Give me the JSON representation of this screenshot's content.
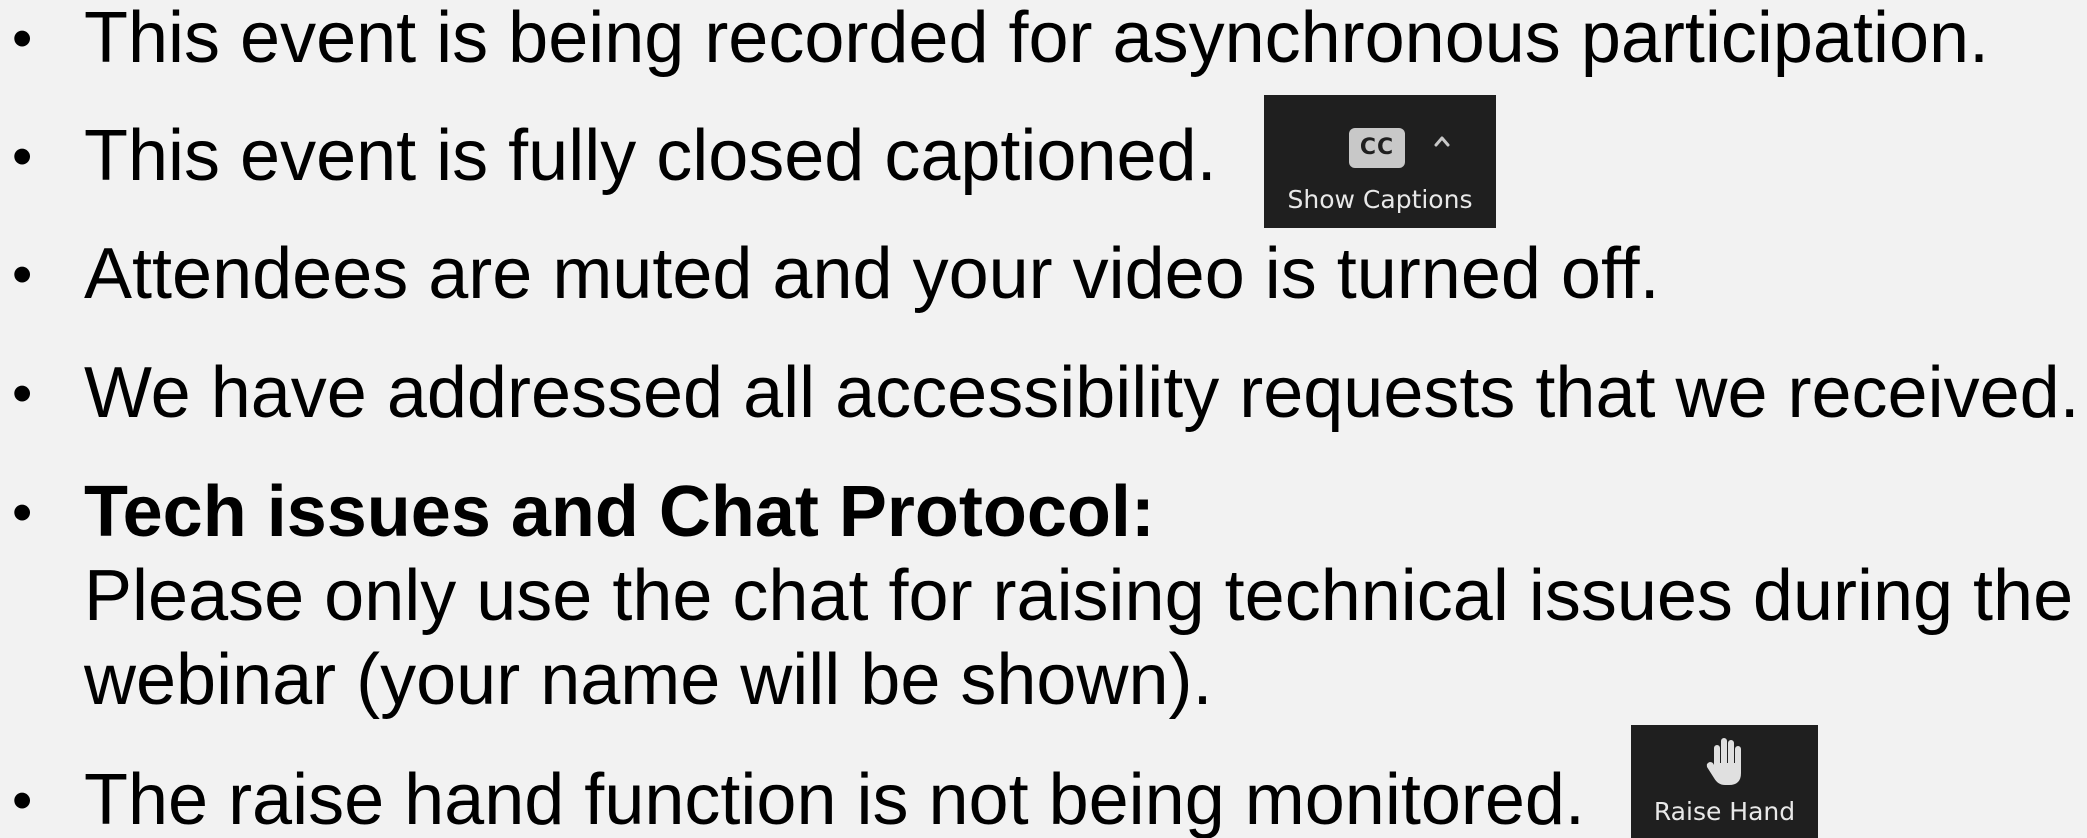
{
  "slide": {
    "bullet_char": "•",
    "items": [
      {
        "text": "This event is being recorded for asynchronous participation."
      },
      {
        "text": "This event is fully closed captioned."
      },
      {
        "text": "Attendees are muted and your video is turned off."
      },
      {
        "text": "We have addressed all accessibility requests that we received."
      },
      {
        "heading": "Tech issues and Chat Protocol:",
        "line1": "Please only use the chat for raising technical issues during the",
        "line2": "webinar (your name will be shown)."
      },
      {
        "text": "The raise hand function is not being monitored."
      }
    ]
  },
  "captions_button": {
    "icon_text": "CC",
    "label": "Show Captions",
    "icon": "closed-captions-icon",
    "chevron_icon": "chevron-up-icon"
  },
  "raise_hand_button": {
    "label": "Raise Hand",
    "icon": "raise-hand-icon"
  },
  "colors": {
    "background": "#f2f2f2",
    "toolbar_button": "#1f1f1f",
    "toolbar_text": "#e8e8e8"
  }
}
